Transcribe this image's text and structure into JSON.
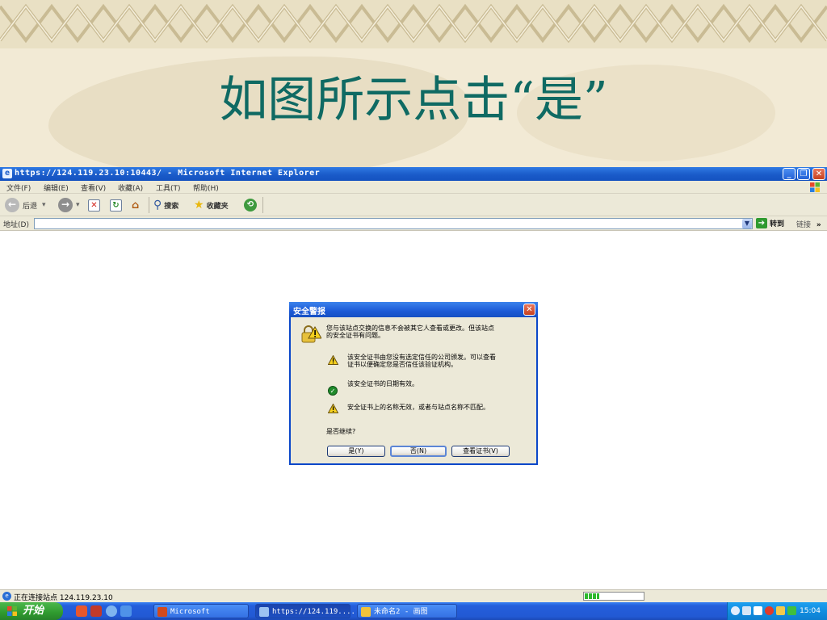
{
  "slide": {
    "title": "如图所示点击“是”"
  },
  "browser": {
    "title": "https://124.119.23.10:10443/ - Microsoft Internet Explorer",
    "menu": [
      "文件(F)",
      "编辑(E)",
      "查看(V)",
      "收藏(A)",
      "工具(T)",
      "帮助(H)"
    ],
    "toolbar": {
      "back": "后退",
      "search": "搜索",
      "favorites": "收藏夹"
    },
    "address": {
      "label": "地址(D)",
      "value": "",
      "go": "转到",
      "links": "链接",
      "more": "»"
    }
  },
  "dialog": {
    "title": "安全警报",
    "intro_line1": "您与该站点交换的信息不会被其它人查看或更改。但该站点",
    "intro_line2": "的安全证书有问题。",
    "item1_line1": "该安全证书由您没有选定信任的公司颁发。可以查看",
    "item1_line2": "证书以便确定您是否信任该验证机构。",
    "item2": "该安全证书的日期有效。",
    "item3": "安全证书上的名称无效，或者与站点名称不匹配。",
    "question": "是否继续?",
    "buttons": {
      "yes": "是(Y)",
      "no": "否(N)",
      "view": "查看证书(V)"
    },
    "colors": {
      "warning": "#f5d01e",
      "valid": "#1f8a2a"
    }
  },
  "status": {
    "text": "正在连接站点 124.119.23.10",
    "progress_percent": 25
  },
  "taskbar": {
    "start": "开始",
    "tasks": [
      "Microsoft PowerP...",
      "https://124.119....",
      "未命名2 - 画图"
    ],
    "active_task_index": 1,
    "clock": "15:04"
  },
  "colors": {
    "title_green": "#0f6a63",
    "xp_blue": "#245edb"
  }
}
